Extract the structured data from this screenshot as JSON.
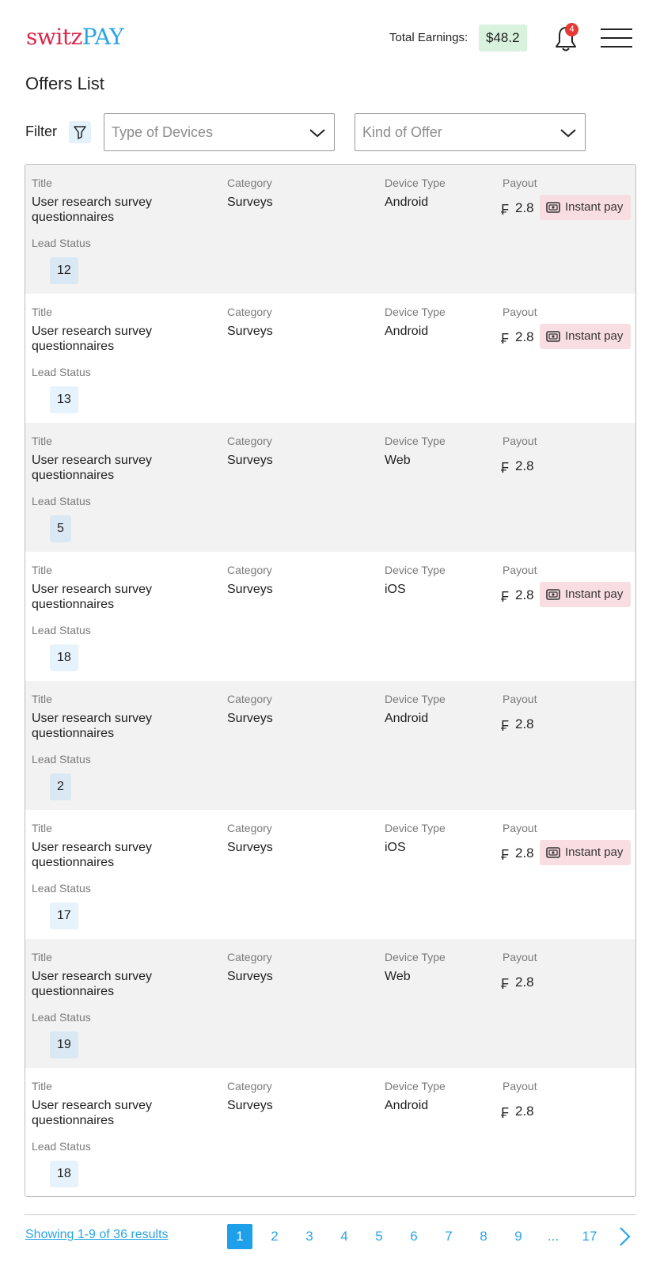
{
  "header": {
    "logo_part1": "switz",
    "logo_part2": "PAY",
    "earnings_label": "Total Earnings:",
    "earnings_value": "$48.2",
    "notification_count": "4"
  },
  "page_title": "Offers List",
  "filter": {
    "label": "Filter",
    "devices_placeholder": "Type of Devices",
    "offer_placeholder": "Kind of Offer"
  },
  "labels": {
    "title": "Title",
    "category": "Category",
    "device_type": "Device Type",
    "payout": "Payout",
    "lead_status": "Lead Status",
    "currency_symbol": "₣",
    "instant_pay": "Instant pay"
  },
  "offers": [
    {
      "title": "User research survey questionnaires",
      "category": "Surveys",
      "device": "Android",
      "payout": "2.8",
      "instant": true,
      "lead_status": "12"
    },
    {
      "title": "User research survey questionnaires",
      "category": "Surveys",
      "device": "Android",
      "payout": "2.8",
      "instant": true,
      "lead_status": "13"
    },
    {
      "title": "User research survey questionnaires",
      "category": "Surveys",
      "device": "Web",
      "payout": "2.8",
      "instant": false,
      "lead_status": "5"
    },
    {
      "title": "User research survey questionnaires",
      "category": "Surveys",
      "device": "iOS",
      "payout": "2.8",
      "instant": true,
      "lead_status": "18"
    },
    {
      "title": "User research survey questionnaires",
      "category": "Surveys",
      "device": "Android",
      "payout": "2.8",
      "instant": false,
      "lead_status": "2"
    },
    {
      "title": "User research survey questionnaires",
      "category": "Surveys",
      "device": "iOS",
      "payout": "2.8",
      "instant": true,
      "lead_status": "17"
    },
    {
      "title": "User research survey questionnaires",
      "category": "Surveys",
      "device": "Web",
      "payout": "2.8",
      "instant": false,
      "lead_status": "19"
    },
    {
      "title": "User research survey questionnaires",
      "category": "Surveys",
      "device": "Android",
      "payout": "2.8",
      "instant": false,
      "lead_status": "18"
    }
  ],
  "pagination": {
    "showing_text": "Showing 1-9 of 36 results",
    "pages": [
      "1",
      "2",
      "3",
      "4",
      "5",
      "6",
      "7",
      "8",
      "9",
      "...",
      "17"
    ],
    "current": "1"
  },
  "colors": {
    "brand_red": "#e0254b",
    "brand_blue": "#2aa4e6",
    "earnings_bg": "#d9f2dd",
    "instant_bg": "#f8dde2",
    "badge_red": "#e53935"
  },
  "icons": [
    "bell-icon",
    "menu-icon",
    "filter-icon",
    "chevron-down-icon",
    "cash-icon",
    "chevron-right-icon"
  ]
}
